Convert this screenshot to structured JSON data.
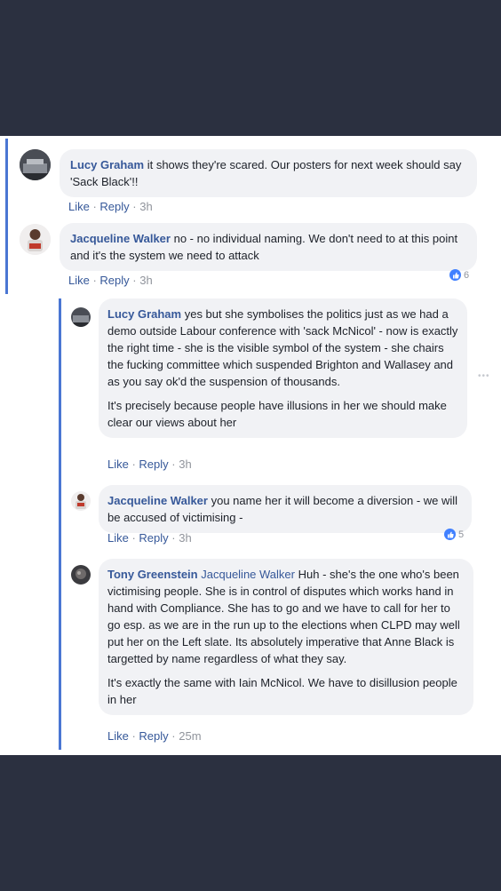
{
  "actions": {
    "like": "Like",
    "reply": "Reply",
    "sep": " · "
  },
  "comments": [
    {
      "author": "Lucy Graham",
      "text": "it shows they're scared. Our posters for next week should say 'Sack Black'!!",
      "time": "3h"
    },
    {
      "author": "Jacqueline Walker",
      "text": "no - no individual naming. We don't need to at this point and it's the system we need to attack",
      "time": "3h",
      "reactions": "6"
    },
    {
      "author": "Lucy Graham",
      "text": "yes but she symbolises the politics just as we had a demo outside Labour conference with 'sack McNicol' - now is exactly the right time - she is the visible symbol of the system - she chairs the fucking committee which suspended Brighton and Wallasey and as you say ok'd the suspension of thousands.",
      "text2": "It's precisely because people have illusions in her we should make clear our views about her",
      "time": "3h"
    },
    {
      "author": "Jacqueline Walker",
      "text": "you name her it will become a diversion - we will be accused of victimising -",
      "time": "3h",
      "reactions": "5"
    },
    {
      "author": "Tony Greenstein",
      "mention": "Jacqueline Walker",
      "text": "Huh - she's the one who's been victimising people. She is in control of disputes which works hand in hand with Compliance. She has to go and we have to call for her to go esp. as we are in the run up to the elections when CLPD may well put her on the Left slate. Its absolutely imperative that Anne Black is targetted by name regardless of what they say.",
      "text2": "It's exactly the same with Iain McNicol. We have to disillusion people in her",
      "time": "25m"
    }
  ],
  "colors": {
    "link": "#365899",
    "thread": "#4a76d3",
    "bubble": "#f1f2f5",
    "like_badge": "#4080ff"
  }
}
